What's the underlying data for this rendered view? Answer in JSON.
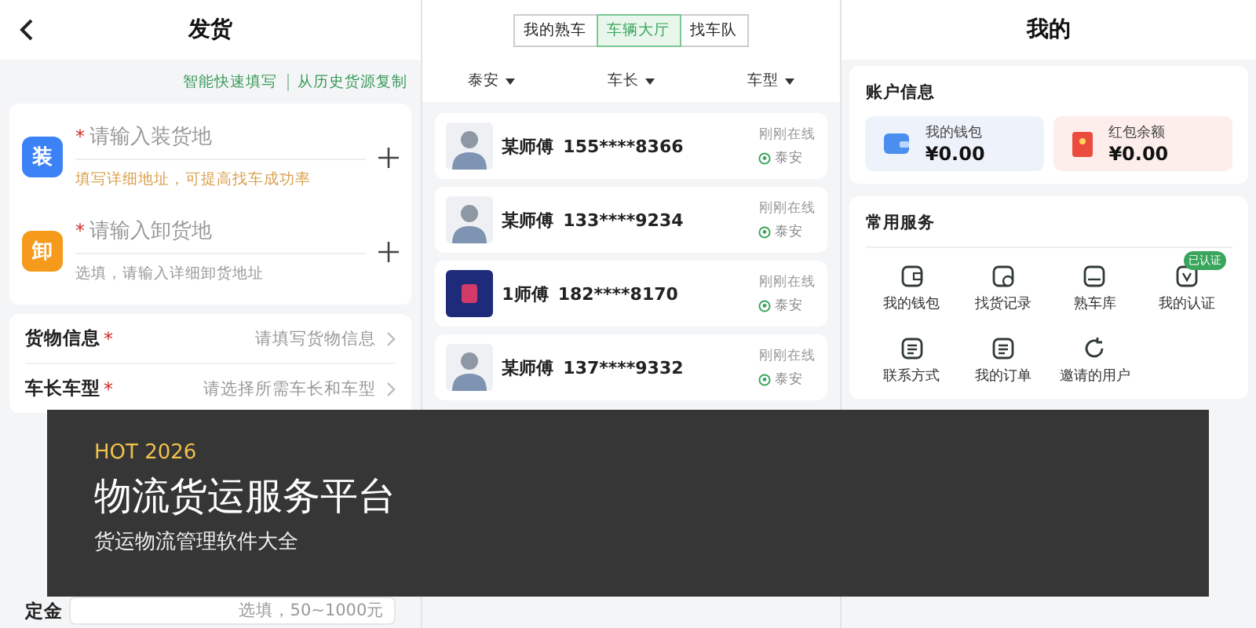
{
  "shipping": {
    "title": "发货",
    "links": [
      "智能快速填写",
      "从历史货源复制"
    ],
    "addresses": [
      {
        "tag": "装",
        "color": "#3b82f6",
        "mark": "*",
        "placeholder": "请输入装货地",
        "hint": "填写详细地址，可提高找车成功率",
        "hint_warning": true
      },
      {
        "tag": "卸",
        "color": "#f59a1b",
        "mark": "*",
        "placeholder": "请输入卸货地",
        "hint": "选填，请输入详细卸货地址",
        "hint_warning": false
      }
    ],
    "form": [
      {
        "label": "货物信息",
        "mark": "*",
        "placeholder": "请填写货物信息"
      },
      {
        "label": "车长车型",
        "mark": "*",
        "placeholder": "请选择所需车长和车型"
      }
    ],
    "fees": [
      {
        "label": "定金",
        "placeholder": "选填，50~1000元"
      }
    ]
  },
  "vehicles": {
    "tabs": [
      {
        "label": "我的熟车",
        "selected": false
      },
      {
        "label": "车辆大厅",
        "selected": true
      },
      {
        "label": "找车队",
        "selected": false
      }
    ],
    "filters": [
      "泰安",
      "车长",
      "车型"
    ],
    "drivers": [
      {
        "photo": false,
        "name": "某师傅",
        "phone": "155****8366",
        "status": "刚刚在线",
        "location": "泰安"
      },
      {
        "photo": false,
        "name": "某师傅",
        "phone": "133****9234",
        "status": "刚刚在线",
        "location": "泰安"
      },
      {
        "photo": true,
        "name": "1师傅",
        "phone": "182****8170",
        "status": "刚刚在线",
        "location": "泰安"
      },
      {
        "photo": false,
        "name": "某师傅",
        "phone": "137****9332",
        "status": "刚刚在线",
        "location": "泰安"
      }
    ]
  },
  "profile": {
    "title": "我的",
    "account_title": "账户信息",
    "balances": [
      {
        "kind": "wallet",
        "label": "我的钱包",
        "amount": "¥0.00"
      },
      {
        "kind": "redpacket",
        "label": "红包余额",
        "amount": "¥0.00"
      }
    ],
    "services_title": "常用服务",
    "services": [
      {
        "label": "我的钱包"
      },
      {
        "label": "找货记录"
      },
      {
        "label": "熟车库"
      },
      {
        "label": "我的认证",
        "badge": "已认证"
      },
      {
        "label": "联系方式"
      },
      {
        "label": "我的订单"
      },
      {
        "label": "邀请的用户"
      }
    ]
  },
  "banner": {
    "tag": "HOT 2026",
    "title": "物流货运服务平台",
    "subtitle": "货运物流管理软件大全"
  }
}
